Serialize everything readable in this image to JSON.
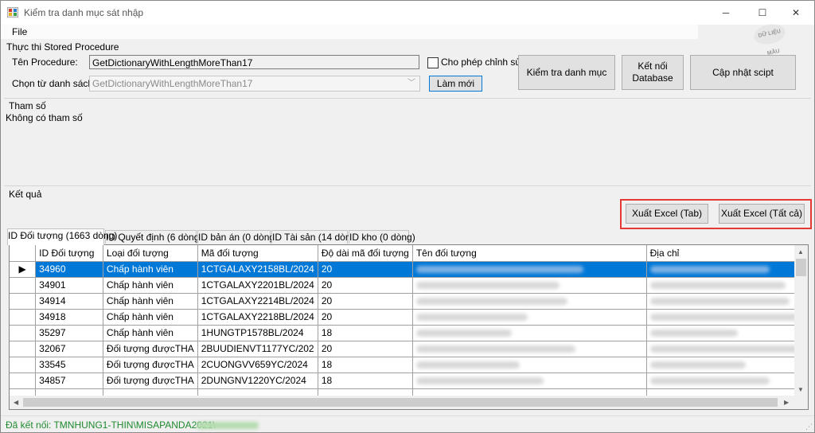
{
  "window": {
    "title": "Kiểm tra danh mục sát nhập",
    "minimize_glyph": "─",
    "maximize_glyph": "☐",
    "close_glyph": "✕",
    "watermark_text": "DỮ LIỆU MẪU"
  },
  "menu": {
    "file": "File"
  },
  "stored_procedure": {
    "group_label": "Thực thi Stored Procedure",
    "procedure_label": "Tên Procedure:",
    "procedure_value": "GetDictionaryWithLengthMoreThan17",
    "list_label": "Chọn từ danh sách:",
    "list_selected": "GetDictionaryWithLengthMoreThan17",
    "allow_edit_label": "Cho phép chỉnh sửa",
    "allow_edit_checked": false,
    "refresh_button": "Làm mới"
  },
  "actions": {
    "check_button": "Kiểm tra danh mục",
    "connect_button": "Kết nối\nDatabase",
    "update_button": "Cập nhật scipt"
  },
  "params": {
    "group_label": "Tham số",
    "empty_text": "Không có tham số"
  },
  "results": {
    "group_label": "Kết quả",
    "export_tab_button": "Xuất Excel (Tab)",
    "export_all_button": "Xuất Excel (Tất cả)",
    "highlight_color": "#e53935"
  },
  "tabs": [
    {
      "label": "ID Đối tượng (1663 dòng)",
      "active": true
    },
    {
      "label": "ID Quyết định (6 dòng)",
      "active": false
    },
    {
      "label": "ID bản án (0 dòng)",
      "active": false
    },
    {
      "label": "ID Tài sản (14 dòng)",
      "active": false
    },
    {
      "label": "ID kho (0 dòng)",
      "active": false
    }
  ],
  "grid": {
    "columns": [
      "ID Đối tượng",
      "Loại đối tượng",
      "Mã đối tượng",
      "Độ dài mã đối tượng",
      "Tên đối tượng",
      "Địa chỉ"
    ],
    "current_row_marker": "▶",
    "rows": [
      {
        "id": "34960",
        "type": "Chấp hành viên",
        "code": "1CTGALAXY2158BL/2024",
        "len": "20",
        "selected": true
      },
      {
        "id": "34901",
        "type": "Chấp hành viên",
        "code": "1CTGALAXY2201BL/2024",
        "len": "20",
        "selected": false
      },
      {
        "id": "34914",
        "type": "Chấp hành viên",
        "code": "1CTGALAXY2214BL/2024",
        "len": "20",
        "selected": false
      },
      {
        "id": "34918",
        "type": "Chấp hành viên",
        "code": "1CTGALAXY2218BL/2024",
        "len": "20",
        "selected": false
      },
      {
        "id": "35297",
        "type": "Chấp hành viên",
        "code": "1HUNGTP1578BL/2024",
        "len": "18",
        "selected": false
      },
      {
        "id": "32067",
        "type": "Đối tượng đượcTHA",
        "code": "2BUUDIENVT1177YC/202",
        "len": "20",
        "selected": false
      },
      {
        "id": "33545",
        "type": "Đối tượng đượcTHA",
        "code": "2CUONGVV659YC/2024",
        "len": "18",
        "selected": false
      },
      {
        "id": "34857",
        "type": "Đối tượng đượcTHA",
        "code": "2DUNGNV1220YC/2024",
        "len": "18",
        "selected": false
      }
    ]
  },
  "status": {
    "text": "Đã kết nối: TMNHUNG1-THIN\\MISAPANDA2021\\",
    "color": "#1e8a2e"
  },
  "colors": {
    "selection": "#0078d7",
    "window_bg": "#f0f0f0"
  }
}
